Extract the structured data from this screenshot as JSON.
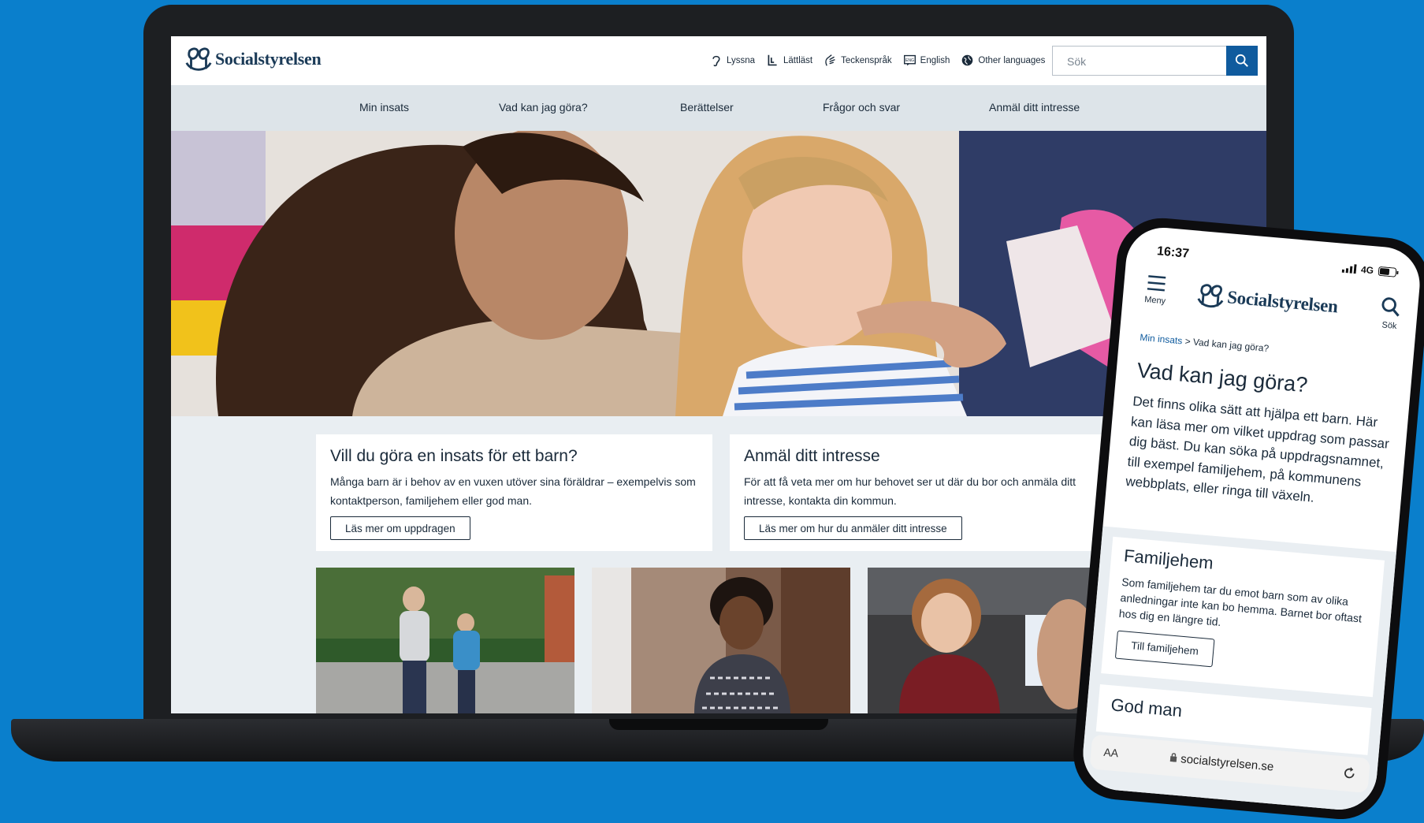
{
  "colors": {
    "background": "#0a7fcc",
    "brand_navy": "#1a3a57",
    "link_blue": "#0f5b9e",
    "nav_gray": "#dde4e9",
    "content_gray": "#e9eef2"
  },
  "desktop": {
    "logo_text": "Socialstyrelsen",
    "tools": [
      {
        "label": "Lyssna",
        "icon": "ear-icon"
      },
      {
        "label": "Lättläst",
        "icon": "easy-read-icon"
      },
      {
        "label": "Teckenspråk",
        "icon": "sign-language-icon"
      },
      {
        "label": "English",
        "icon": "english-flag-icon"
      },
      {
        "label": "Other languages",
        "icon": "globe-icon"
      }
    ],
    "search_placeholder": "Sök",
    "nav": [
      "Min insats",
      "Vad kan jag göra?",
      "Berättelser",
      "Frågor och svar",
      "Anmäl ditt intresse"
    ],
    "cards": [
      {
        "title": "Vill du göra en insats för ett barn?",
        "text": "Många barn är i behov av en vuxen utöver sina föräldrar – exempelvis som kontaktperson, familjehem eller god man.",
        "button": "Läs mer om uppdragen"
      },
      {
        "title": "Anmäl ditt intresse",
        "text": "För att få veta mer om hur behovet ser ut där du bor och anmäla ditt intresse, kontakta din kommun.",
        "button": "Läs mer om hur du anmäler ditt intresse"
      }
    ]
  },
  "mobile": {
    "time": "16:37",
    "network": "4G",
    "menu_label": "Meny",
    "logo_text": "Socialstyrelsen",
    "search_label": "Sök",
    "breadcrumb": {
      "link": "Min insats",
      "separator": ">",
      "current": "Vad kan jag göra?"
    },
    "title": "Vad kan jag göra?",
    "intro": "Det finns olika sätt att hjälpa ett barn. Här kan läsa mer om vilket uppdrag som passar dig bäst. Du kan söka på uppdragsnamnet, till exempel familjehem, på kommunens webbplats, eller ringa till växeln.",
    "card": {
      "title": "Familjehem",
      "text": "Som familjehem tar du emot barn som av olika anledningar inte kan bo hemma. Barnet bor oftast hos dig en längre tid.",
      "button": "Till familjehem"
    },
    "card2_title": "God man",
    "url_aa": "AA",
    "url": "socialstyrelsen.se"
  }
}
